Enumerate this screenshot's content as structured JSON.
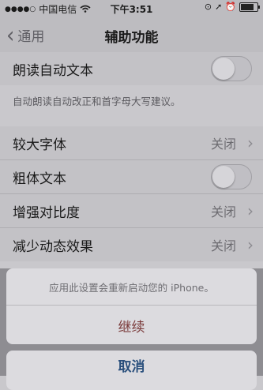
{
  "status_bar": {
    "carrier": "中国电信",
    "time": "下午3:51"
  },
  "nav": {
    "back_label": "通用",
    "title": "辅助功能"
  },
  "settings": {
    "speak_autotext": {
      "label": "朗读自动文本",
      "enabled": false
    },
    "speak_autotext_note": "自动朗读自动改正和首字母大写建议。",
    "larger_text": {
      "label": "较大字体",
      "value": "关闭"
    },
    "bold_text": {
      "label": "粗体文本",
      "enabled": false
    },
    "increase_contrast": {
      "label": "增强对比度",
      "value": "关闭"
    },
    "reduce_motion": {
      "label": "减少动态效果",
      "value": "关闭"
    }
  },
  "action_sheet": {
    "message": "应用此设置会重新启动您的 iPhone。",
    "continue_label": "继续",
    "cancel_label": "取消"
  }
}
